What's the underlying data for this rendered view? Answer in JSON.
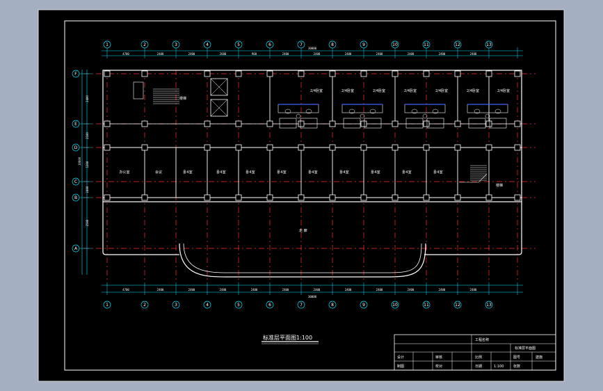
{
  "drawing": {
    "title": "标准层平面图1:100",
    "top_axis_labels": [
      "1",
      "2",
      "3",
      "4",
      "5",
      "6",
      "7",
      "8",
      "9",
      "10",
      "11",
      "12",
      "13"
    ],
    "bottom_axis_labels": [
      "1",
      "2",
      "3",
      "4",
      "5",
      "6",
      "7",
      "8",
      "9",
      "10",
      "11",
      "12",
      "13"
    ],
    "left_axis_labels": [
      "A",
      "B",
      "C",
      "D",
      "E",
      "F"
    ],
    "top_dims": [
      "4700",
      "2400",
      "2400",
      "2600",
      "900",
      "2400",
      "2400",
      "2400",
      "2400",
      "2400",
      "2400",
      "2400"
    ],
    "bottom_dims": [
      "4700",
      "2400",
      "2400",
      "2400",
      "2400",
      "2400",
      "2400",
      "2400",
      "2400",
      "2400",
      "2400",
      "2400"
    ],
    "overall_dim": "30000",
    "left_dims": [
      "2400",
      "2100",
      "1200",
      "2400",
      "2500"
    ],
    "left_total_dim": "10600",
    "upper_rooms": [
      "2/4卧室",
      "2/4卧室",
      "2/4卧室",
      "2/4卧室",
      "2/4卧室",
      "2/4卧室",
      "2/4卧室"
    ],
    "lower_rooms": [
      "办公室",
      "会议",
      "卧4室",
      "卧4室",
      "卧4室",
      "卧4室",
      "卧4室",
      "卧4室",
      "卧4室",
      "卧4室",
      "卧4室"
    ],
    "stair_label": "楼梯",
    "stair2_label": "楼梯",
    "corridor_label": "走 廊"
  },
  "title_block": {
    "row1": [
      "工程名称",
      ""
    ],
    "row2": [
      "",
      "标准层平面图"
    ],
    "row3": [
      "设计",
      "",
      "审核",
      "",
      "比例",
      "",
      "图号",
      "建施"
    ],
    "row4": [
      "制图",
      "",
      "校对",
      "",
      "日期",
      "1:100",
      "张数",
      ""
    ]
  },
  "colors": {
    "outer_bg": "#a4b0c2",
    "sheet_bg": "#000000",
    "border": "#ffffff",
    "axis": "#ff3030",
    "wall": "#ffffff",
    "dim": "#00e5ff",
    "fixture": "#4060ff"
  }
}
